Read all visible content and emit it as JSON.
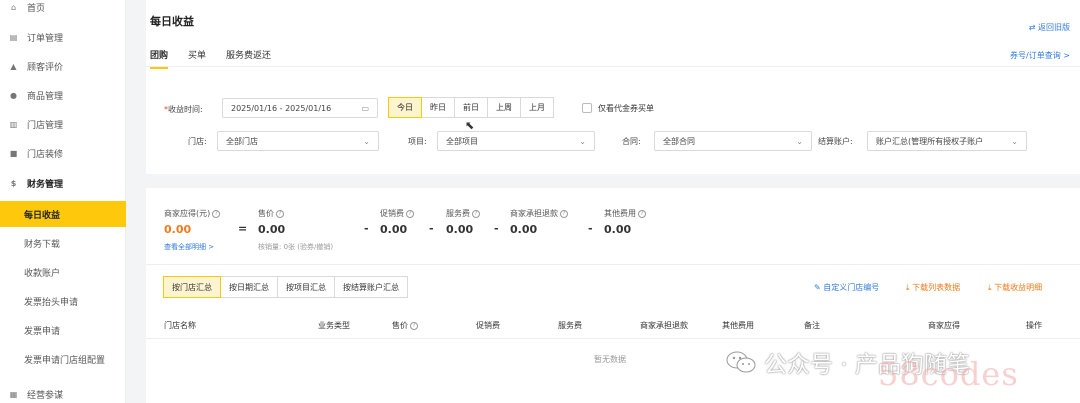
{
  "sidebar": {
    "items": [
      {
        "label": "首页",
        "icon": "home-icon",
        "glyph": "⌂"
      },
      {
        "label": "订单管理",
        "icon": "order-icon",
        "glyph": "▤"
      },
      {
        "label": "顾客评价",
        "icon": "thumb-icon",
        "glyph": "▲"
      },
      {
        "label": "商品管理",
        "icon": "goods-icon",
        "glyph": "●"
      },
      {
        "label": "门店管理",
        "icon": "store-icon",
        "glyph": "▥"
      },
      {
        "label": "门店装修",
        "icon": "decor-icon",
        "glyph": "■"
      },
      {
        "label": "财务管理",
        "icon": "finance-icon",
        "glyph": "$"
      }
    ],
    "sub": [
      "每日收益",
      "财务下载",
      "收款账户",
      "发票抬头申请",
      "发票申请",
      "发票申请门店组配置"
    ],
    "bottom": {
      "label": "经营参谋",
      "icon": "chart-icon",
      "glyph": "▦"
    }
  },
  "header": {
    "title": "每日收益",
    "back_link": "⇄ 返回旧版",
    "tabs": [
      "团购",
      "买单",
      "服务费返还"
    ],
    "right_link": "券号/订单查询 >"
  },
  "filters": {
    "date_label": "收益时间:",
    "date_value": "2025/01/16 - 2025/01/16",
    "quick": [
      "今日",
      "昨日",
      "前日",
      "上周",
      "上月"
    ],
    "checkbox_label": "仅看代金券买单",
    "store_label": "门店:",
    "store_value": "全部门店",
    "project_label": "项目:",
    "project_value": "全部项目",
    "contract_label": "合同:",
    "contract_value": "全部合同",
    "account_label": "结算账户:",
    "account_value": "账户汇总(管理所有授权子账户"
  },
  "summary": {
    "items": [
      {
        "label": "商家应得(元)",
        "value": "0.00"
      },
      {
        "label": "售价",
        "value": "0.00"
      },
      {
        "label": "促销费",
        "value": "0.00"
      },
      {
        "label": "服务费",
        "value": "0.00"
      },
      {
        "label": "商家承担退款",
        "value": "0.00"
      },
      {
        "label": "其他费用",
        "value": "0.00"
      }
    ],
    "ops": [
      "=",
      "-",
      "-",
      "-",
      "-"
    ],
    "detail_link": "查看全部明细 >",
    "sub_hint": "核销量: 0张 (验券/撤销)"
  },
  "table": {
    "tabs": [
      "按门店汇总",
      "按日期汇总",
      "按项目汇总",
      "按结算账户汇总"
    ],
    "actions": [
      "✎ 自定义门店编号",
      "⤓ 下载列表数据",
      "⤓ 下载收益明细"
    ],
    "columns": [
      "门店名称",
      "业务类型",
      "售价",
      "促销费",
      "服务费",
      "商家承担退款",
      "其他费用",
      "备注",
      "商家应得",
      "操作"
    ],
    "empty": "暂无数据"
  },
  "watermark": {
    "text": "公众号 · 产品狗随笔",
    "site": "58codes"
  }
}
